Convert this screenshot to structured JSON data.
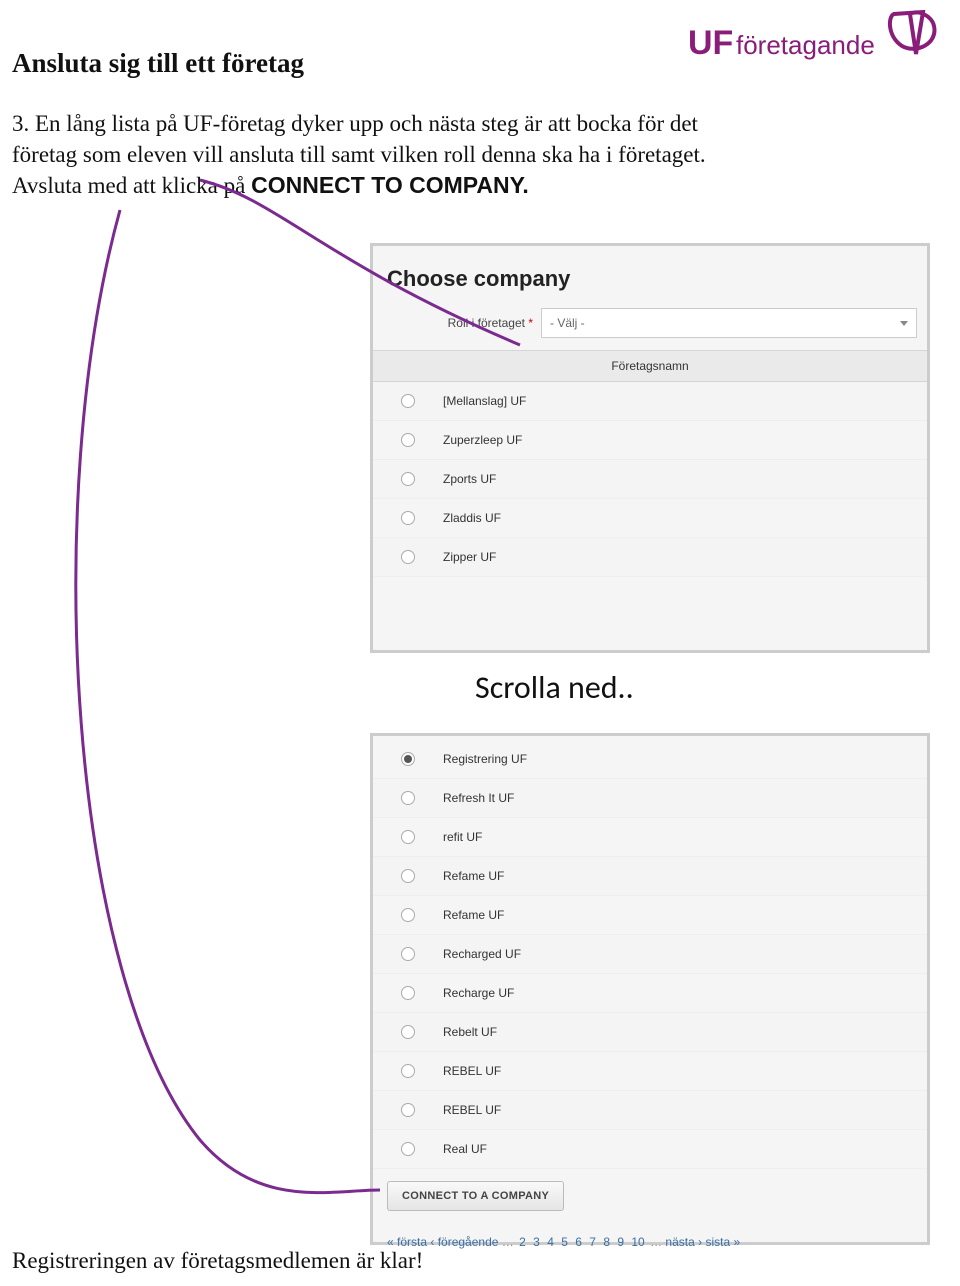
{
  "logo": {
    "bold_text": "UF",
    "thin_text": "företagande"
  },
  "title": "Ansluta sig till ett företag",
  "paragraph": {
    "prefix": "3. En lång lista på UF-företag dyker upp och nästa steg är att bocka för det företag som eleven vill ansluta till samt vilken roll denna ska ha i företaget. Avsluta med att klicka på ",
    "bold": "CONNECT TO COMPANY."
  },
  "panel": {
    "title": "Choose company",
    "role_label": "Roll i företaget",
    "role_star": "*",
    "role_value": "- Välj -",
    "list_header": "Företagsnamn"
  },
  "companies_top": [
    {
      "name": "[Mellanslag] UF",
      "selected": false
    },
    {
      "name": "Zuperzleep UF",
      "selected": false
    },
    {
      "name": "Zports UF",
      "selected": false
    },
    {
      "name": "Zladdis UF",
      "selected": false
    },
    {
      "name": "Zipper UF",
      "selected": false
    }
  ],
  "scroll_label": "Scrolla ned..",
  "companies_bottom": [
    {
      "name": "Registrering UF",
      "selected": true
    },
    {
      "name": "Refresh It UF",
      "selected": false
    },
    {
      "name": "refit UF",
      "selected": false
    },
    {
      "name": "Refame UF",
      "selected": false
    },
    {
      "name": "Refame UF",
      "selected": false
    },
    {
      "name": "Recharged UF",
      "selected": false
    },
    {
      "name": "Recharge UF",
      "selected": false
    },
    {
      "name": "Rebelt UF",
      "selected": false
    },
    {
      "name": "REBEL UF",
      "selected": false
    },
    {
      "name": "REBEL UF",
      "selected": false
    },
    {
      "name": "Real UF",
      "selected": false
    }
  ],
  "connect_button": "CONNECT TO A COMPANY",
  "pager": {
    "first": "« första",
    "prev": "‹ föregående",
    "dots1": "…",
    "nums": [
      "2",
      "3",
      "4",
      "5",
      "6",
      "7",
      "8",
      "9",
      "10"
    ],
    "dots2": "…",
    "next": "nästa ›",
    "last": "sista »"
  },
  "footer": "Registreringen av företagsmedlemen är klar!"
}
